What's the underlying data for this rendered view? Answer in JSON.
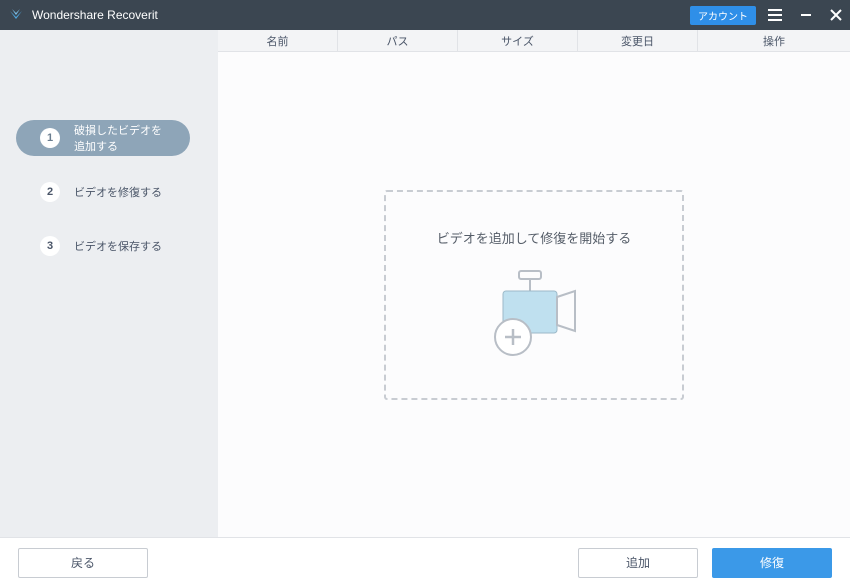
{
  "titlebar": {
    "title": "Wondershare Recoverit",
    "account_label": "アカウント"
  },
  "sidebar": {
    "steps": [
      {
        "num": "1",
        "label": "破損したビデオを追加する",
        "active": true
      },
      {
        "num": "2",
        "label": "ビデオを修復する",
        "active": false
      },
      {
        "num": "3",
        "label": "ビデオを保存する",
        "active": false
      }
    ]
  },
  "table": {
    "headers": {
      "name": "名前",
      "path": "パス",
      "size": "サイズ",
      "date": "変更日",
      "action": "操作"
    }
  },
  "dropzone": {
    "text": "ビデオを追加して修復を開始する"
  },
  "footer": {
    "back": "戻る",
    "add": "追加",
    "repair": "修復"
  },
  "colors": {
    "accent": "#3b99e8",
    "titlebar": "#3b4651",
    "sidebar_active": "#8ea5b8"
  }
}
